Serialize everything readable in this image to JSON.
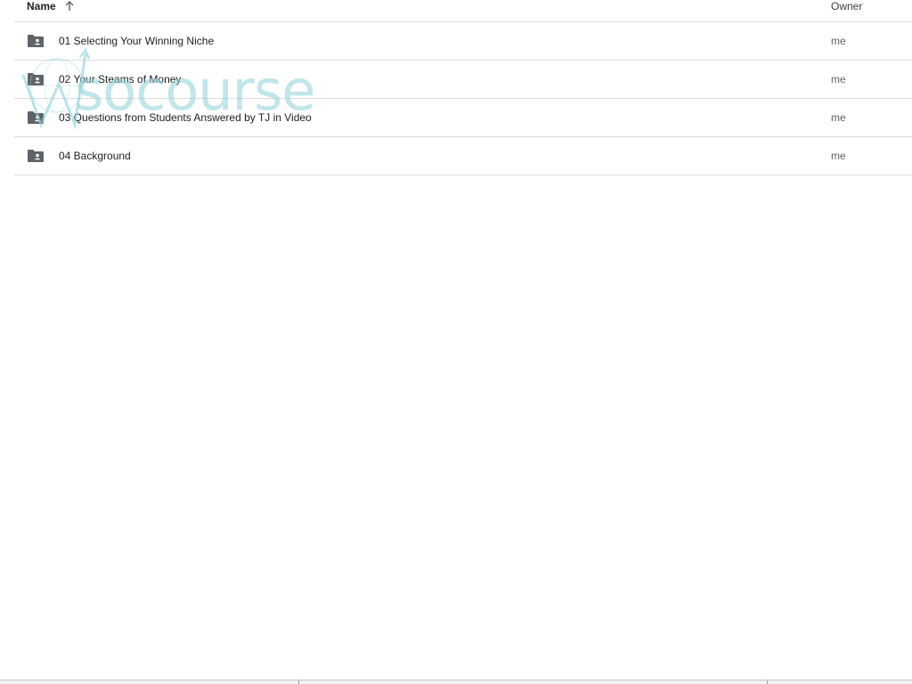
{
  "header": {
    "name_label": "Name",
    "owner_label": "Owner",
    "sort_direction": "ascending"
  },
  "rows": [
    {
      "icon": "shared-folder-icon",
      "name": "01 Selecting Your Winning Niche",
      "owner": "me"
    },
    {
      "icon": "shared-folder-icon",
      "name": "02 Your Steams of Money",
      "owner": "me"
    },
    {
      "icon": "shared-folder-icon",
      "name": "03 Questions from Students Answered by TJ in Video",
      "owner": "me"
    },
    {
      "icon": "shared-folder-icon",
      "name": "04 Background",
      "owner": "me"
    }
  ],
  "watermark": {
    "text": "socourse",
    "color": "#8cd2d7"
  },
  "colors": {
    "folder_icon": "#5f6368",
    "divider": "#dadce0",
    "text_primary": "#202124",
    "text_secondary": "#5f6368"
  }
}
